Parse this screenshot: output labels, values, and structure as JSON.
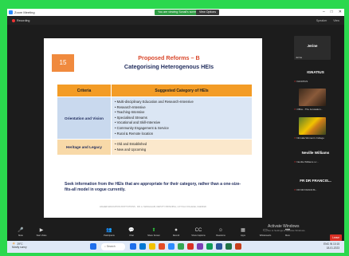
{
  "window": {
    "title": "Zoom Meeting",
    "share_notice": "You are viewing Sonali's screen",
    "view_options": "View Options",
    "controls": [
      "–",
      "□",
      "✕"
    ]
  },
  "meeting": {
    "recording_label": "Recording",
    "right_links": [
      "Speaker",
      "View"
    ]
  },
  "slide": {
    "number": "15",
    "title_line1": "Proposed Reforms – B",
    "title_line2": "Categorising Heterogenous HEIs",
    "table": {
      "headers": [
        "Criteria",
        "Suggested Category of HEIs"
      ],
      "rows": [
        {
          "criteria": "Orientation and Vision",
          "items": [
            "Multi-disciplinary Education and Research-Intensive",
            "Research-Intensive",
            "Teaching-Intensive",
            "Specialised Streams",
            "Vocational and Skill-Intensive",
            "Community Engagement & Service",
            "Rural & Remote location"
          ]
        },
        {
          "criteria": "Heritage and Legacy",
          "items": [
            "Old and Established",
            "New and Upcoming"
          ]
        }
      ]
    },
    "note": "Seek information from the HEIs that are appropriate for their category, rather than a one-size-fits-all model in vogue currently.",
    "footer": "HIGHER EDUCATION INSTITUTIONS · DR. A. MANGALAM, DEPUTY PRINCIPAL, LOYOLA COLLEGE, CHENNAI"
  },
  "panel": {
    "self_tile": {
      "name": "Jerine",
      "label": "Jerine"
    },
    "ignatius": {
      "name": "IGNATIUS",
      "label": "IGNATIUS"
    },
    "thumb1_label": "Office - The Jerusalem...",
    "thumb2_label": "Nirmala Women's College",
    "neville": {
      "name": "Neville Williams",
      "label": "Neville Williams s.r..."
    },
    "francis": {
      "name": "FR DR FRANCIS...",
      "label": "FR DR FRANCIS..."
    }
  },
  "activation": {
    "title": "Activate Windows",
    "subtitle": "Go to Settings to activate Windows."
  },
  "toolbar": {
    "leave": "Leave",
    "items": [
      {
        "icon": "microphone-icon",
        "glyph": "🎤",
        "label": "Mute"
      },
      {
        "icon": "video-icon",
        "glyph": "▶",
        "label": "Start Video"
      },
      {
        "icon": "participants-icon",
        "glyph": "👥",
        "label": "Participants"
      },
      {
        "icon": "chat-icon",
        "glyph": "💬",
        "label": "Chat"
      },
      {
        "icon": "share-screen-icon",
        "glyph": "⬆",
        "label": "Share Screen"
      },
      {
        "icon": "record-icon",
        "glyph": "⏺",
        "label": "Record"
      },
      {
        "icon": "captions-icon",
        "glyph": "CC",
        "label": "Show Captions"
      },
      {
        "icon": "reactions-icon",
        "glyph": "☺",
        "label": "Reactions"
      },
      {
        "icon": "apps-icon",
        "glyph": "▦",
        "label": "Apps"
      },
      {
        "icon": "whiteboard-icon",
        "glyph": "▭",
        "label": "Whiteboards"
      },
      {
        "icon": "more-icon",
        "glyph": "•••",
        "label": "More"
      }
    ]
  },
  "taskbar": {
    "weather_temp": "29°C",
    "weather_desc": "Mostly sunny",
    "search_label": "Search",
    "lang": "ENG",
    "region": "IN",
    "time": "10:15",
    "date": "18-01-2023",
    "app_colors": [
      "#1f6feb",
      "#0078d4",
      "#f2c200",
      "#e34c26",
      "#2d8cff",
      "#34a853",
      "#d93025",
      "#7b3fb5",
      "#0f9d58",
      "#2b579a",
      "#217346",
      "#c43e1c"
    ]
  }
}
